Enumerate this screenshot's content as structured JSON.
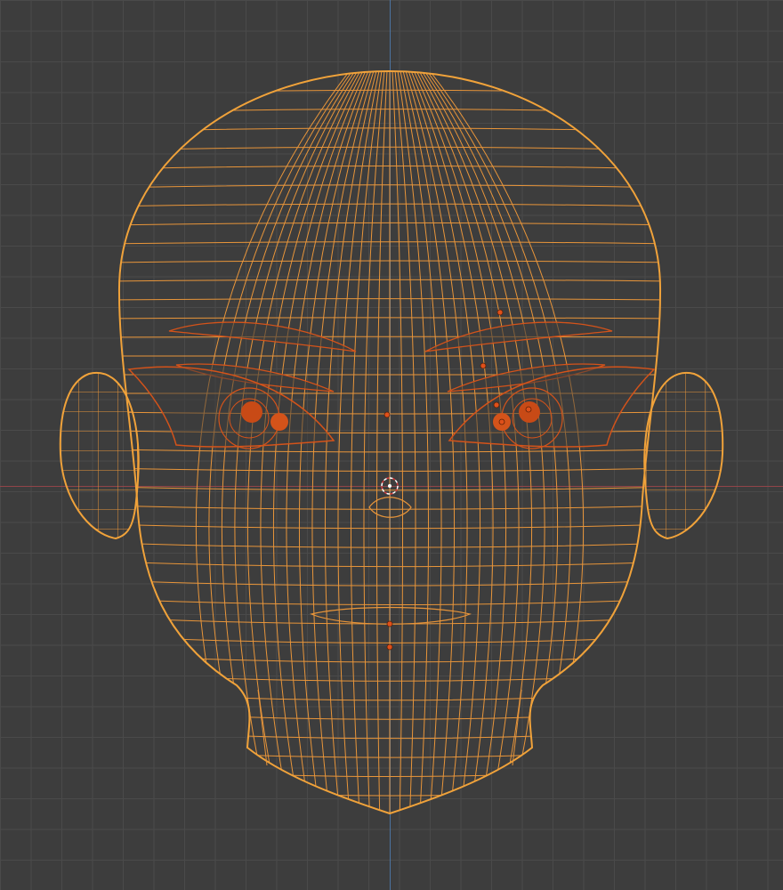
{
  "viewport": {
    "mode": "edit-mode-wireframe",
    "view": "front-orthographic",
    "object": "head-mesh",
    "colors": {
      "background": "#3d3d3d",
      "grid": "#4a4a4a",
      "x_axis": "#a0454a",
      "z_axis": "#4f7cb0",
      "selected_wire": "#f0a23a",
      "active_wire": "#d4531a",
      "vertex": "#e0501a",
      "origin": "#ffffff"
    },
    "icons": [
      "3d-cursor-icon",
      "object-origin-icon"
    ]
  }
}
